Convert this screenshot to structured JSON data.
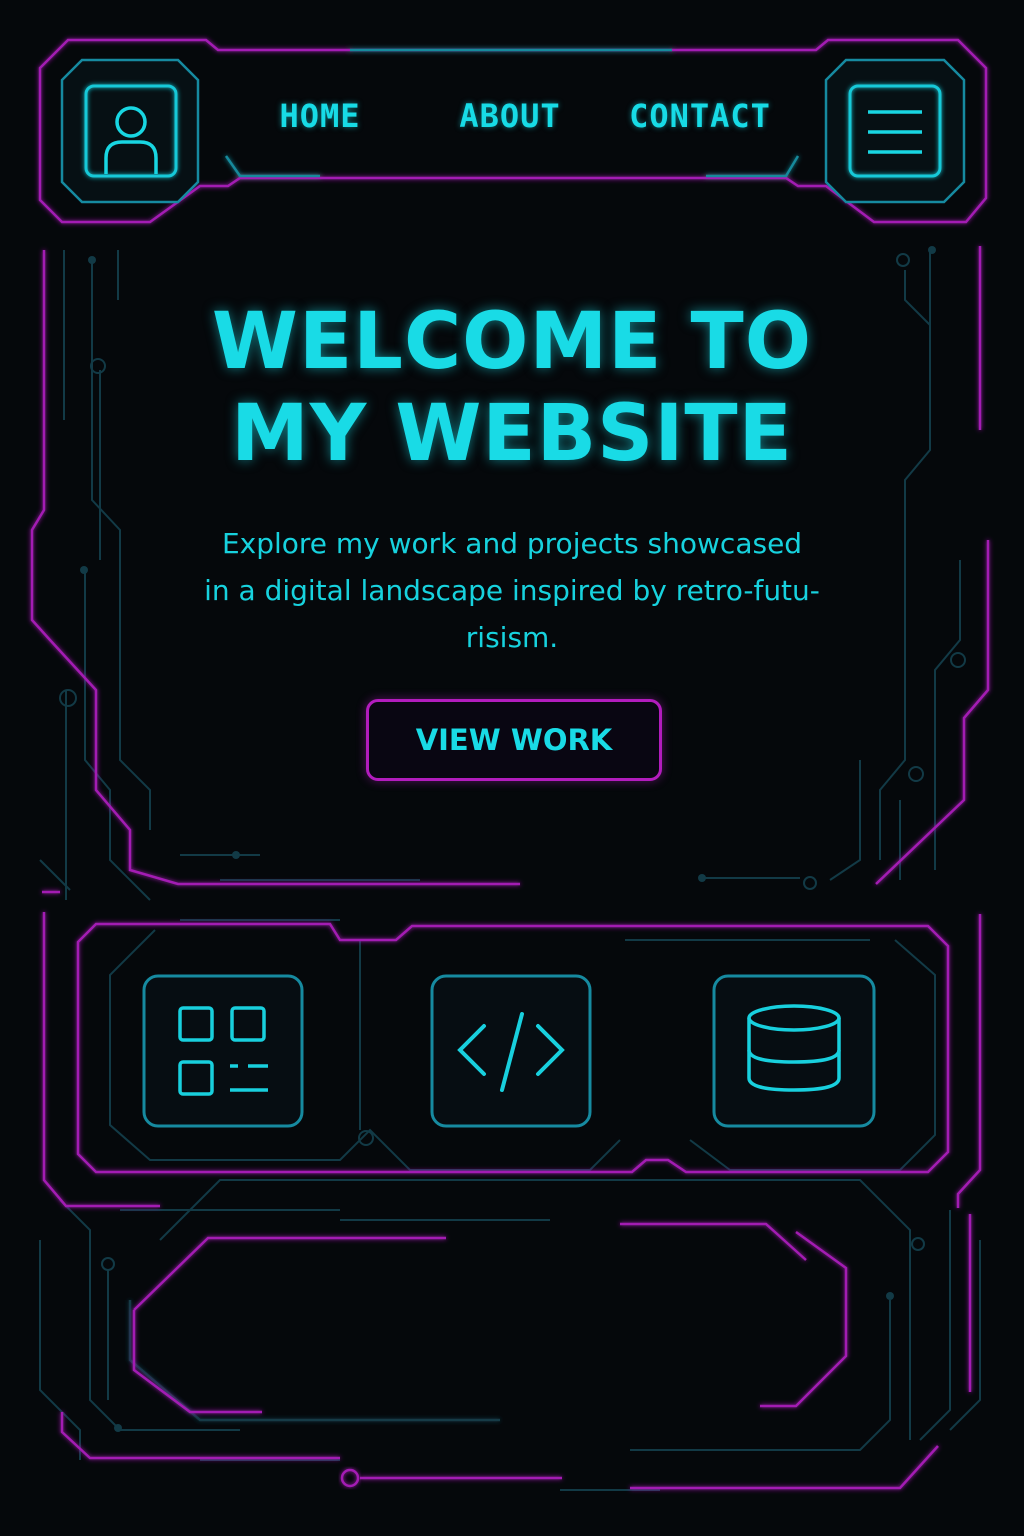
{
  "nav": {
    "items": [
      {
        "label": "HOME"
      },
      {
        "label": "ABOUT"
      },
      {
        "label": "CONTACT"
      }
    ],
    "profile_icon": "user-icon",
    "menu_icon": "hamburger-menu-icon"
  },
  "hero": {
    "title_line1": "WELCOME TO",
    "title_line2": "MY WEBSITE",
    "subtitle_line1": "Explore my work and projects showcased",
    "subtitle_line2": "in a digital landscape inspired by retro-futu-",
    "subtitle_line3": "risism.",
    "cta_label": "VIEW WORK"
  },
  "features": {
    "icons": [
      "dashboard-grid-icon",
      "code-icon",
      "database-icon"
    ]
  },
  "colors": {
    "background": "#05080b",
    "accent_cyan": "#17dbe6",
    "accent_magenta": "#b21cbd",
    "circuit_dim": "#123c48"
  }
}
